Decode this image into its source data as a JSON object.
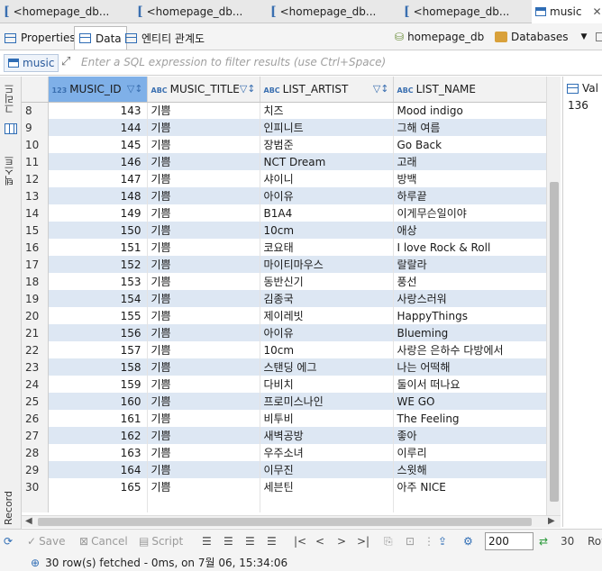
{
  "editor_tabs": [
    {
      "label": "<homepage_db...",
      "icon": "sql-script-icon"
    },
    {
      "label": "<homepage_db...",
      "icon": "sql-script-icon"
    },
    {
      "label": "<homepage_db...",
      "icon": "sql-script-icon"
    },
    {
      "label": "<homepage_db...",
      "icon": "sql-script-icon"
    },
    {
      "label": "music",
      "icon": "table-icon",
      "active": true
    }
  ],
  "sub_tabs": {
    "properties": "Properties",
    "data": "Data",
    "er": "엔티티 관계도"
  },
  "breadcrumb": {
    "database": "homepage_db",
    "databases": "Databases"
  },
  "filter": {
    "entity": "music",
    "placeholder": "Enter a SQL expression to filter results (use Ctrl+Space)"
  },
  "side_labels": {
    "grid": "그리드",
    "text": "텍스트",
    "record": "Record"
  },
  "grid": {
    "columns": [
      {
        "name": "MUSIC_ID",
        "type": "123"
      },
      {
        "name": "MUSIC_TITLE",
        "type": "ABC"
      },
      {
        "name": "LIST_ARTIST",
        "type": "ABC"
      },
      {
        "name": "LIST_NAME",
        "type": "ABC"
      }
    ],
    "rows": [
      {
        "n": "8",
        "id": "143",
        "title": "기쁨",
        "artist": "치즈",
        "name": "Mood indigo"
      },
      {
        "n": "9",
        "id": "144",
        "title": "기쁨",
        "artist": "인피니트",
        "name": "그해 여름"
      },
      {
        "n": "10",
        "id": "145",
        "title": "기쁨",
        "artist": "장범준",
        "name": "Go Back"
      },
      {
        "n": "11",
        "id": "146",
        "title": "기쁨",
        "artist": "NCT Dream",
        "name": "고래"
      },
      {
        "n": "12",
        "id": "147",
        "title": "기쁨",
        "artist": "샤이니",
        "name": "방백"
      },
      {
        "n": "13",
        "id": "148",
        "title": "기쁨",
        "artist": "아이유",
        "name": "하루끝"
      },
      {
        "n": "14",
        "id": "149",
        "title": "기쁨",
        "artist": "B1A4",
        "name": "이게무슨일이야"
      },
      {
        "n": "15",
        "id": "150",
        "title": "기쁨",
        "artist": "10cm",
        "name": "애상"
      },
      {
        "n": "16",
        "id": "151",
        "title": "기쁨",
        "artist": "코요태",
        "name": "I love Rock & Roll"
      },
      {
        "n": "17",
        "id": "152",
        "title": "기쁨",
        "artist": "마이티마우스",
        "name": "랄랄라"
      },
      {
        "n": "18",
        "id": "153",
        "title": "기쁨",
        "artist": "동반신기",
        "name": "풍선"
      },
      {
        "n": "19",
        "id": "154",
        "title": "기쁨",
        "artist": "김종국",
        "name": "사랑스러워"
      },
      {
        "n": "20",
        "id": "155",
        "title": "기쁨",
        "artist": "제이레빗",
        "name": "HappyThings"
      },
      {
        "n": "21",
        "id": "156",
        "title": "기쁨",
        "artist": "아이유",
        "name": "Blueming"
      },
      {
        "n": "22",
        "id": "157",
        "title": "기쁨",
        "artist": "10cm",
        "name": "사랑은 은하수 다방에서"
      },
      {
        "n": "23",
        "id": "158",
        "title": "기쁨",
        "artist": "스탠딩 에그",
        "name": "나는 어떡해"
      },
      {
        "n": "24",
        "id": "159",
        "title": "기쁨",
        "artist": "다비치",
        "name": "둘이서 떠나요"
      },
      {
        "n": "25",
        "id": "160",
        "title": "기쁨",
        "artist": "프로미스나인",
        "name": "WE GO"
      },
      {
        "n": "26",
        "id": "161",
        "title": "기쁨",
        "artist": "비투비",
        "name": "The Feeling"
      },
      {
        "n": "27",
        "id": "162",
        "title": "기쁨",
        "artist": "새벽공방",
        "name": "좋아"
      },
      {
        "n": "28",
        "id": "163",
        "title": "기쁨",
        "artist": "우주소녀",
        "name": "이루리"
      },
      {
        "n": "29",
        "id": "164",
        "title": "기쁨",
        "artist": "이무진",
        "name": "스윗해"
      },
      {
        "n": "30",
        "id": "165",
        "title": "기쁨",
        "artist": "세븐틴",
        "name": "아주 NICE"
      }
    ]
  },
  "value_panel": {
    "header": "Val",
    "value": "136"
  },
  "toolbar": {
    "save": "Save",
    "cancel": "Cancel",
    "script": "Script",
    "fetch_size": "200",
    "row_count": "30",
    "rows_label": "Row"
  },
  "status": "30 row(s) fetched - 0ms, on 7월 06, 15:34:06",
  "colors": {
    "accent": "#2f6db5",
    "selected_header": "#7fb0e8",
    "alt_row": "#dde7f3"
  }
}
